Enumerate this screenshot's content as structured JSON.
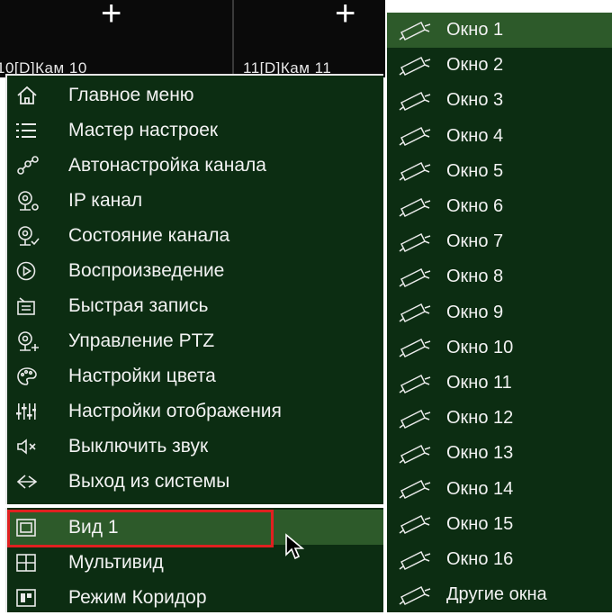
{
  "cameras": [
    {
      "label": "10[D]Кам 10"
    },
    {
      "label": "11[D]Кам 11"
    }
  ],
  "main_menu": {
    "items": [
      {
        "icon": "home-icon",
        "label": "Главное меню"
      },
      {
        "icon": "list-icon",
        "label": "Мастер настроек"
      },
      {
        "icon": "auto-channel-icon",
        "label": "Автонастройка канала"
      },
      {
        "icon": "ip-camera-icon",
        "label": "IP канал"
      },
      {
        "icon": "channel-status-icon",
        "label": "Состояние канала"
      },
      {
        "icon": "play-icon",
        "label": "Воспроизведение"
      },
      {
        "icon": "quick-record-icon",
        "label": "Быстрая запись"
      },
      {
        "icon": "ptz-icon",
        "label": "Управление PTZ"
      },
      {
        "icon": "palette-icon",
        "label": "Настройки цвета"
      },
      {
        "icon": "sliders-icon",
        "label": "Настройки отображения"
      },
      {
        "icon": "mute-icon",
        "label": "Выключить звук"
      },
      {
        "icon": "logout-icon",
        "label": "Выход из системы"
      }
    ]
  },
  "view_menu": {
    "items": [
      {
        "icon": "single-view-icon",
        "label": "Вид 1",
        "active": true
      },
      {
        "icon": "multi-view-icon",
        "label": "Мультивид",
        "active": false
      },
      {
        "icon": "corridor-icon",
        "label": "Режим Коридор",
        "active": false
      }
    ]
  },
  "window_menu": {
    "items": [
      {
        "label": "Окно 1",
        "active": true
      },
      {
        "label": "Окно 2"
      },
      {
        "label": "Окно 3"
      },
      {
        "label": "Окно 4"
      },
      {
        "label": "Окно 5"
      },
      {
        "label": "Окно 6"
      },
      {
        "label": "Окно 7"
      },
      {
        "label": "Окно 8"
      },
      {
        "label": "Окно 9"
      },
      {
        "label": "Окно 10"
      },
      {
        "label": "Окно 11"
      },
      {
        "label": "Окно 12"
      },
      {
        "label": "Окно 13"
      },
      {
        "label": "Окно 14"
      },
      {
        "label": "Окно 15"
      },
      {
        "label": "Окно 16"
      },
      {
        "label": "Другие окна"
      }
    ]
  },
  "colors": {
    "menu_bg": "#0c2d12",
    "active_bg": "#2d5a2a",
    "highlight_border": "#e02020"
  }
}
